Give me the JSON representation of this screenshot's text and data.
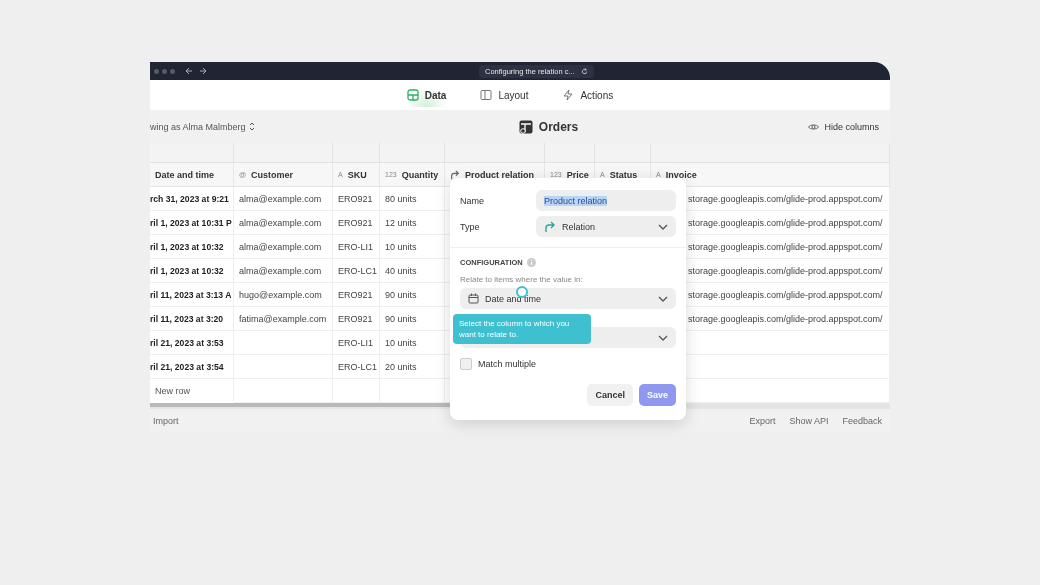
{
  "browser": {
    "url": "Configuring the relation c..."
  },
  "tabs": [
    {
      "label": "Data",
      "selected": true
    },
    {
      "label": "Layout",
      "selected": false
    },
    {
      "label": "Actions",
      "selected": false
    }
  ],
  "toolbar": {
    "viewing_as": "wing as Alma Malmberg",
    "title": "Orders",
    "hide_columns": "Hide columns"
  },
  "table": {
    "columns": [
      {
        "label": "Date and time",
        "kind": "plain"
      },
      {
        "label": "Customer",
        "kind": "glyph",
        "glyph": "@"
      },
      {
        "label": "SKU",
        "kind": "glyph",
        "glyph": "A"
      },
      {
        "label": "Quantity",
        "kind": "glyph",
        "glyph": "123"
      },
      {
        "label": "Product relation",
        "kind": "relation"
      },
      {
        "label": "Price",
        "kind": "glyph",
        "glyph": "123"
      },
      {
        "label": "Status",
        "kind": "glyph",
        "glyph": "A"
      },
      {
        "label": "Invoice",
        "kind": "glyph",
        "glyph": "A"
      }
    ],
    "rows": [
      [
        "rch 31, 2023 at 9:21",
        "alma@example.com",
        "ERO921",
        "80 units",
        "storage.googleapis.com/glide-prod.appspot.com/"
      ],
      [
        "ril 1, 2023 at 10:31 P",
        "alma@example.com",
        "ERO921",
        "12 units",
        "storage.googleapis.com/glide-prod.appspot.com/"
      ],
      [
        "ril 1, 2023 at 10:32",
        "alma@example.com",
        "ERO-LI1",
        "10 units",
        "storage.googleapis.com/glide-prod.appspot.com/"
      ],
      [
        "ril 1, 2023 at 10:32",
        "alma@example.com",
        "ERO-LC1",
        "40 units",
        "storage.googleapis.com/glide-prod.appspot.com/"
      ],
      [
        "ril 11, 2023 at 3:13 A",
        "hugo@example.com",
        "ERO921",
        "90 units",
        "storage.googleapis.com/glide-prod.appspot.com/"
      ],
      [
        "ril 11, 2023 at 3:20",
        "fatima@example.com",
        "ERO921",
        "90 units",
        "storage.googleapis.com/glide-prod.appspot.com/"
      ],
      [
        "ril 21, 2023 at 3:53",
        "",
        "ERO-LI1",
        "10 units",
        ""
      ],
      [
        "ril 21, 2023 at 3:54",
        "",
        "ERO-LC1",
        "20 units",
        ""
      ]
    ],
    "new_row": "New row"
  },
  "footer": {
    "import": "Import",
    "links": [
      "Export",
      "Show API",
      "Feedback"
    ]
  },
  "dialog": {
    "name_label": "Name",
    "name_value": "Product relation",
    "name_highlighted": true,
    "type_label": "Type",
    "type_value": "Relation",
    "section": "CONFIGURATION",
    "relate_label": "Relate to items where the value in:",
    "relate_value": "Date and time",
    "tooltip": "Select the column to which you want to relate to.",
    "match_multiple": {
      "label": "Match multiple",
      "checked": false
    },
    "cancel": "Cancel",
    "save": {
      "label": "Save",
      "disabled": true
    }
  }
}
